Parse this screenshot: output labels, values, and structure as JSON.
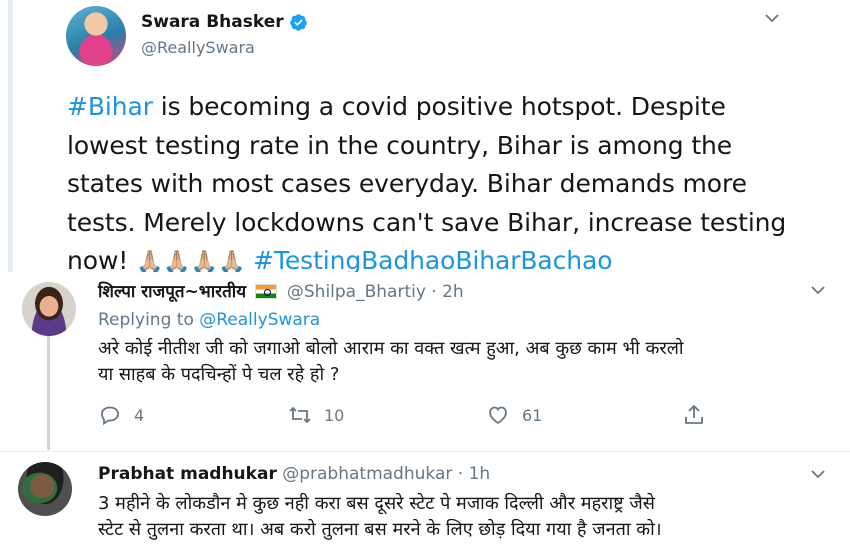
{
  "main_tweet": {
    "author_name": "Swara Bhasker",
    "handle": "@ReallySwara",
    "text_parts": [
      {
        "text": "#Bihar",
        "kind": "hashtag"
      },
      {
        "text": " is becoming a covid positive hotspot. Despite lowest testing rate in the country,  Bihar is among the states with most cases everyday. Bihar demands more tests. Merely lockdowns can't save Bihar, increase testing now! ",
        "kind": "text"
      },
      {
        "text": "🙏🏼🙏🏼🙏🏼🙏🏼",
        "kind": "emoji"
      },
      {
        "text": " ",
        "kind": "text"
      },
      {
        "text": "#TestingBadhaoBiharBachao",
        "kind": "hashtag"
      }
    ]
  },
  "replies": [
    {
      "name": "शिल्पा राजपूत~भारतीय",
      "handle": "@Shilpa_Bhartiy",
      "time": " · 2h",
      "replying_prefix": "Replying to ",
      "replying_to": "@ReallySwara",
      "body_line1": "अरे कोई नीतीश जी को जगाओ बोलो आराम का वक्त खत्म हुआ, अब कुछ काम भी करलो",
      "body_line2": "या साहब के पदचिन्हों पे चल रहे हो ?",
      "reply_count": "4",
      "retweet_count": "10",
      "like_count": "61"
    },
    {
      "name": "Prabhat madhukar",
      "handle": "@prabhatmadhukar",
      "time": " · 1h",
      "body_line1": "3 महीने के लोकडौन मे कुछ नही करा बस दूसरे स्टेट पे मजाक दिल्ली और महराष्ट्र जैसे",
      "body_line2": "स्टेट से तुलना करता था। अब करो तुलना बस मरने के लिए छोड़ दिया गया है जनता को।"
    }
  ],
  "colors": {
    "accent": "#1b95e0",
    "secondary_text": "#657786",
    "divider": "#e6ecf0"
  },
  "icons": [
    "verified-badge-icon",
    "chevron-down-icon",
    "reply-icon",
    "retweet-icon",
    "like-icon",
    "share-icon"
  ]
}
